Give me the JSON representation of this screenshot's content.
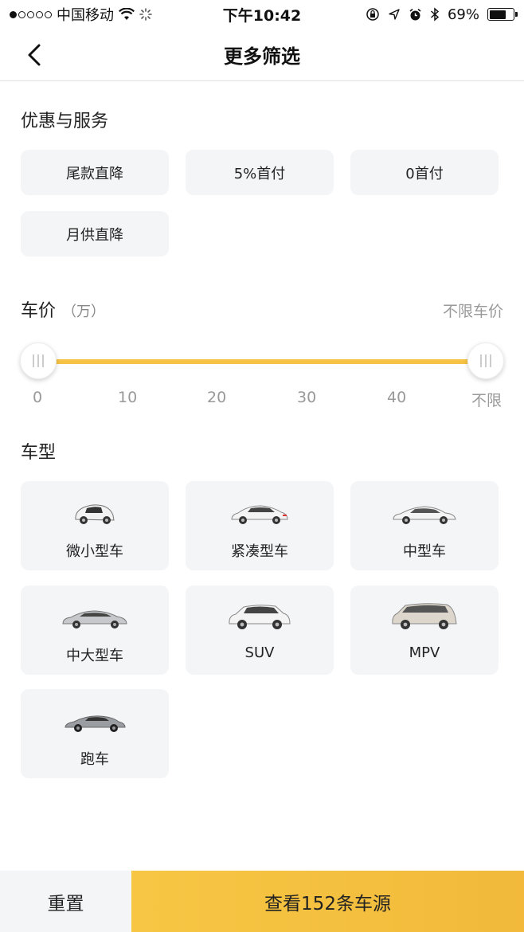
{
  "status_bar": {
    "carrier": "中国移动",
    "time": "下午10:42",
    "battery_percent": "69%",
    "battery_level": 0.69,
    "icons": [
      "signal-icon",
      "wifi-icon",
      "loading-icon",
      "orientation-lock-icon",
      "location-icon",
      "alarm-icon",
      "bluetooth-icon",
      "battery-icon"
    ]
  },
  "nav": {
    "title": "更多筛选",
    "back_icon": "chevron-left-icon"
  },
  "offers": {
    "title": "优惠与服务",
    "chips": [
      "尾款直降",
      "5%首付",
      "0首付",
      "月供直降"
    ]
  },
  "price": {
    "title": "车价",
    "unit": "（万）",
    "hint": "不限车价",
    "ticks": [
      "0",
      "10",
      "20",
      "30",
      "40",
      "不限"
    ],
    "range_min_fraction": 0,
    "range_max_fraction": 1,
    "accent_color": "#f6c344"
  },
  "car_type": {
    "title": "车型",
    "items": [
      {
        "label": "微小型车",
        "icon": "microcar-icon"
      },
      {
        "label": "紧凑型车",
        "icon": "compact-car-icon"
      },
      {
        "label": "中型车",
        "icon": "midsize-car-icon"
      },
      {
        "label": "中大型车",
        "icon": "large-car-icon"
      },
      {
        "label": "SUV",
        "icon": "suv-icon"
      },
      {
        "label": "MPV",
        "icon": "mpv-icon"
      },
      {
        "label": "跑车",
        "icon": "sports-car-icon"
      }
    ]
  },
  "bottom": {
    "reset_label": "重置",
    "view_label": "查看152条车源",
    "accent_color": "#f5c03f"
  }
}
